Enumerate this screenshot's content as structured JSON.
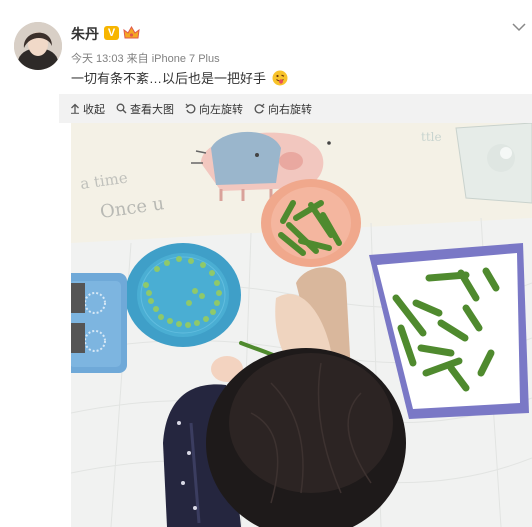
{
  "post": {
    "author": "朱丹",
    "verified_badge": "V",
    "time": "今天 13:03",
    "source": "来自 iPhone 7 Plus",
    "text": "一切有条不紊…以后也是一把好手",
    "emoji_icon": "tongue-face-emoji"
  },
  "toolbar": {
    "collapse_label": "收起",
    "view_large_label": "查看大图",
    "rotate_left_label": "向左旋转",
    "rotate_right_label": "向右旋转"
  },
  "photo": {
    "mat_text_1": "Once u",
    "mat_text_2": "a time"
  },
  "colors": {
    "badge": "#f7b500",
    "toolbar_bg": "#f2f2f2",
    "meta_text": "#808080"
  }
}
